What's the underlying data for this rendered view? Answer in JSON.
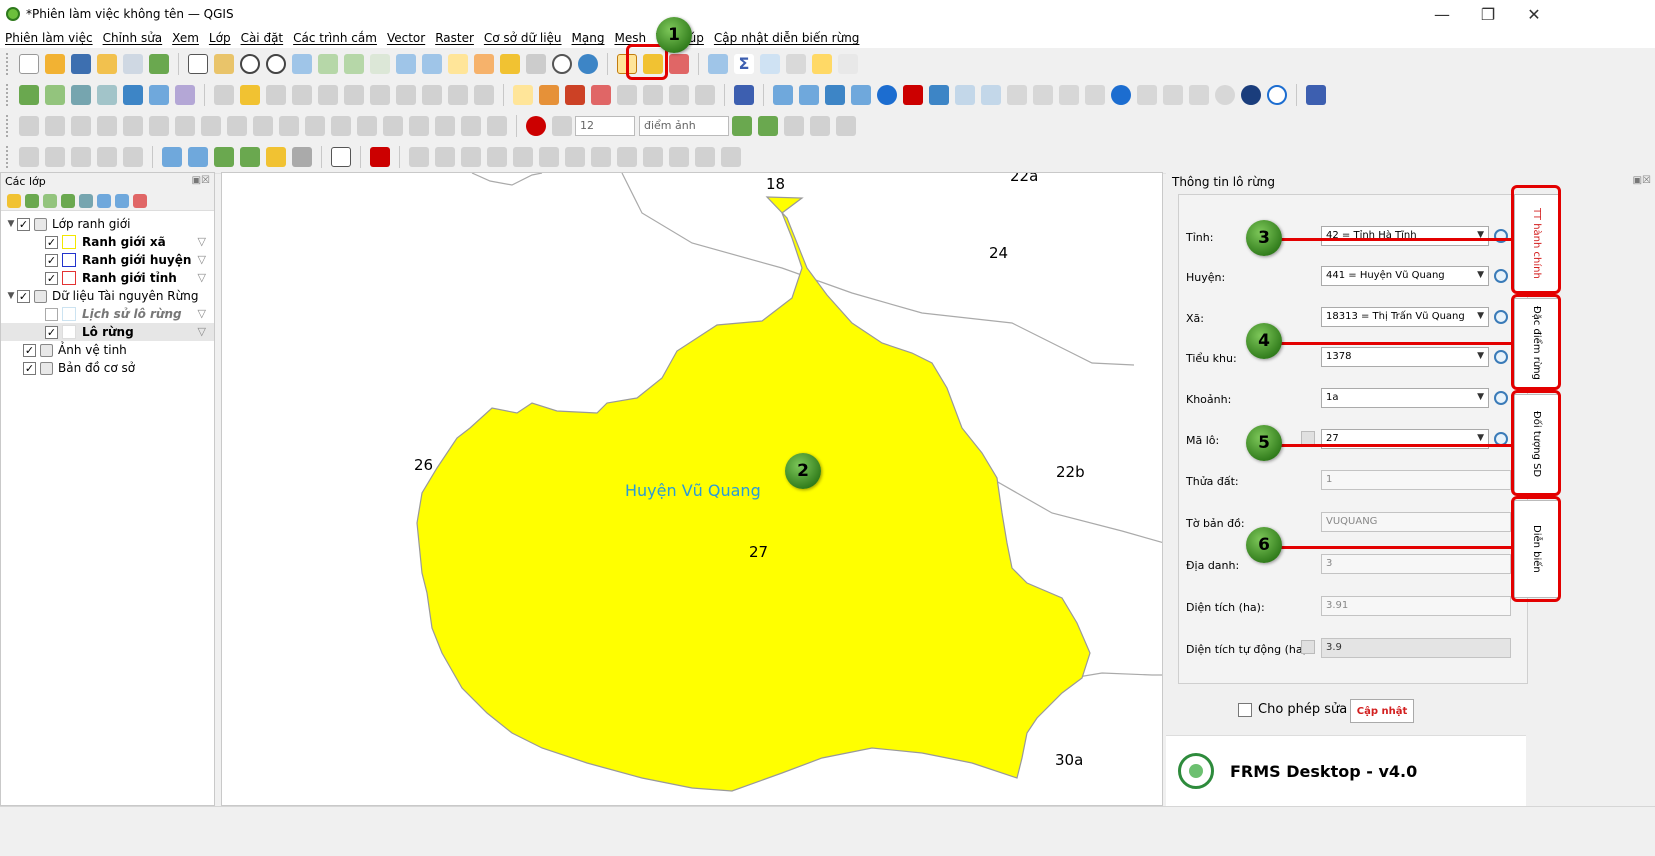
{
  "window": {
    "title": "*Phiên làm việc không tên — QGIS",
    "minimize": "—",
    "maximize": "❐",
    "close": "✕"
  },
  "menu": [
    "Phiên làm việc",
    "Chỉnh sửa",
    "Xem",
    "Lớp",
    "Cài đặt",
    "Các trình cắm",
    "Vector",
    "Raster",
    "Cơ sở dữ liệu",
    "Mạng",
    "Mesh",
    "Trợ giúp",
    "Cập nhật diễn biến rừng"
  ],
  "toolbar": {
    "font_size_value": "12",
    "unit_value": "điểm ảnh"
  },
  "layers_panel": {
    "title": "Các lớp",
    "tree": [
      {
        "label": "Lớp ranh giới",
        "type": "group",
        "checked": true
      },
      {
        "label": "Ranh giới xã",
        "type": "layer",
        "checked": true,
        "symbol_color": "#f3e700"
      },
      {
        "label": "Ranh giới huyện",
        "type": "layer",
        "checked": true,
        "symbol_color": "#2233cc"
      },
      {
        "label": "Ranh giới tỉnh",
        "type": "layer",
        "checked": true,
        "symbol_color": "#e33333"
      },
      {
        "label": "Dữ liệu Tài nguyên Rừng",
        "type": "group",
        "checked": true
      },
      {
        "label": "Lịch sử lô rừng",
        "type": "layer",
        "checked": false,
        "symbol_color": "#cce3f1"
      },
      {
        "label": "Lô rừng",
        "type": "layer",
        "checked": true,
        "symbol_color": "#ffffff"
      },
      {
        "label": "Ảnh vệ tinh",
        "type": "group",
        "checked": true
      },
      {
        "label": "Bản đồ cơ sở",
        "type": "group",
        "checked": true
      }
    ]
  },
  "map": {
    "district_label": "Huyện Vũ Quang",
    "fill_color": "#ffff00",
    "plot_labels": [
      "18",
      "22a",
      "24",
      "26",
      "22b",
      "27",
      "30a"
    ]
  },
  "badges": [
    "1",
    "2",
    "3",
    "4",
    "5",
    "6"
  ],
  "forest_panel": {
    "title": "Thông tin lô rừng",
    "fields": {
      "tinh": {
        "label": "Tỉnh:",
        "value": "42 = Tỉnh Hà Tĩnh"
      },
      "huyen": {
        "label": "Huyện:",
        "value": "441 = Huyện Vũ Quang"
      },
      "xa": {
        "label": "Xã:",
        "value": "18313 = Thị Trấn Vũ Quang"
      },
      "tieu_khu": {
        "label": "Tiểu khu:",
        "value": "1378"
      },
      "khoanh": {
        "label": "Khoảnh:",
        "value": "1a"
      },
      "ma_lo": {
        "label": "Mã lô:",
        "value": "27"
      },
      "thua_dat": {
        "label": "Thửa đất:",
        "value": "1"
      },
      "to_ban_do": {
        "label": "Tờ bản đồ:",
        "value": "VUQUANG"
      },
      "dia_danh": {
        "label": "Địa danh:",
        "value": "3"
      },
      "dien_tich": {
        "label": "Diện tích (ha):",
        "value": "3.91"
      },
      "dien_tich_tu_dong": {
        "label": "Diện tích tự động (ha):",
        "value": "3.9"
      }
    },
    "tabs": [
      "TT hành chính",
      "Đặc điểm rừng",
      "Đối tượng SD",
      "Diễn biến"
    ],
    "allow_edit_label": "Cho phép sửa",
    "update_button": "Cập nhật",
    "brand": "FRMS Desktop - v4.0"
  }
}
